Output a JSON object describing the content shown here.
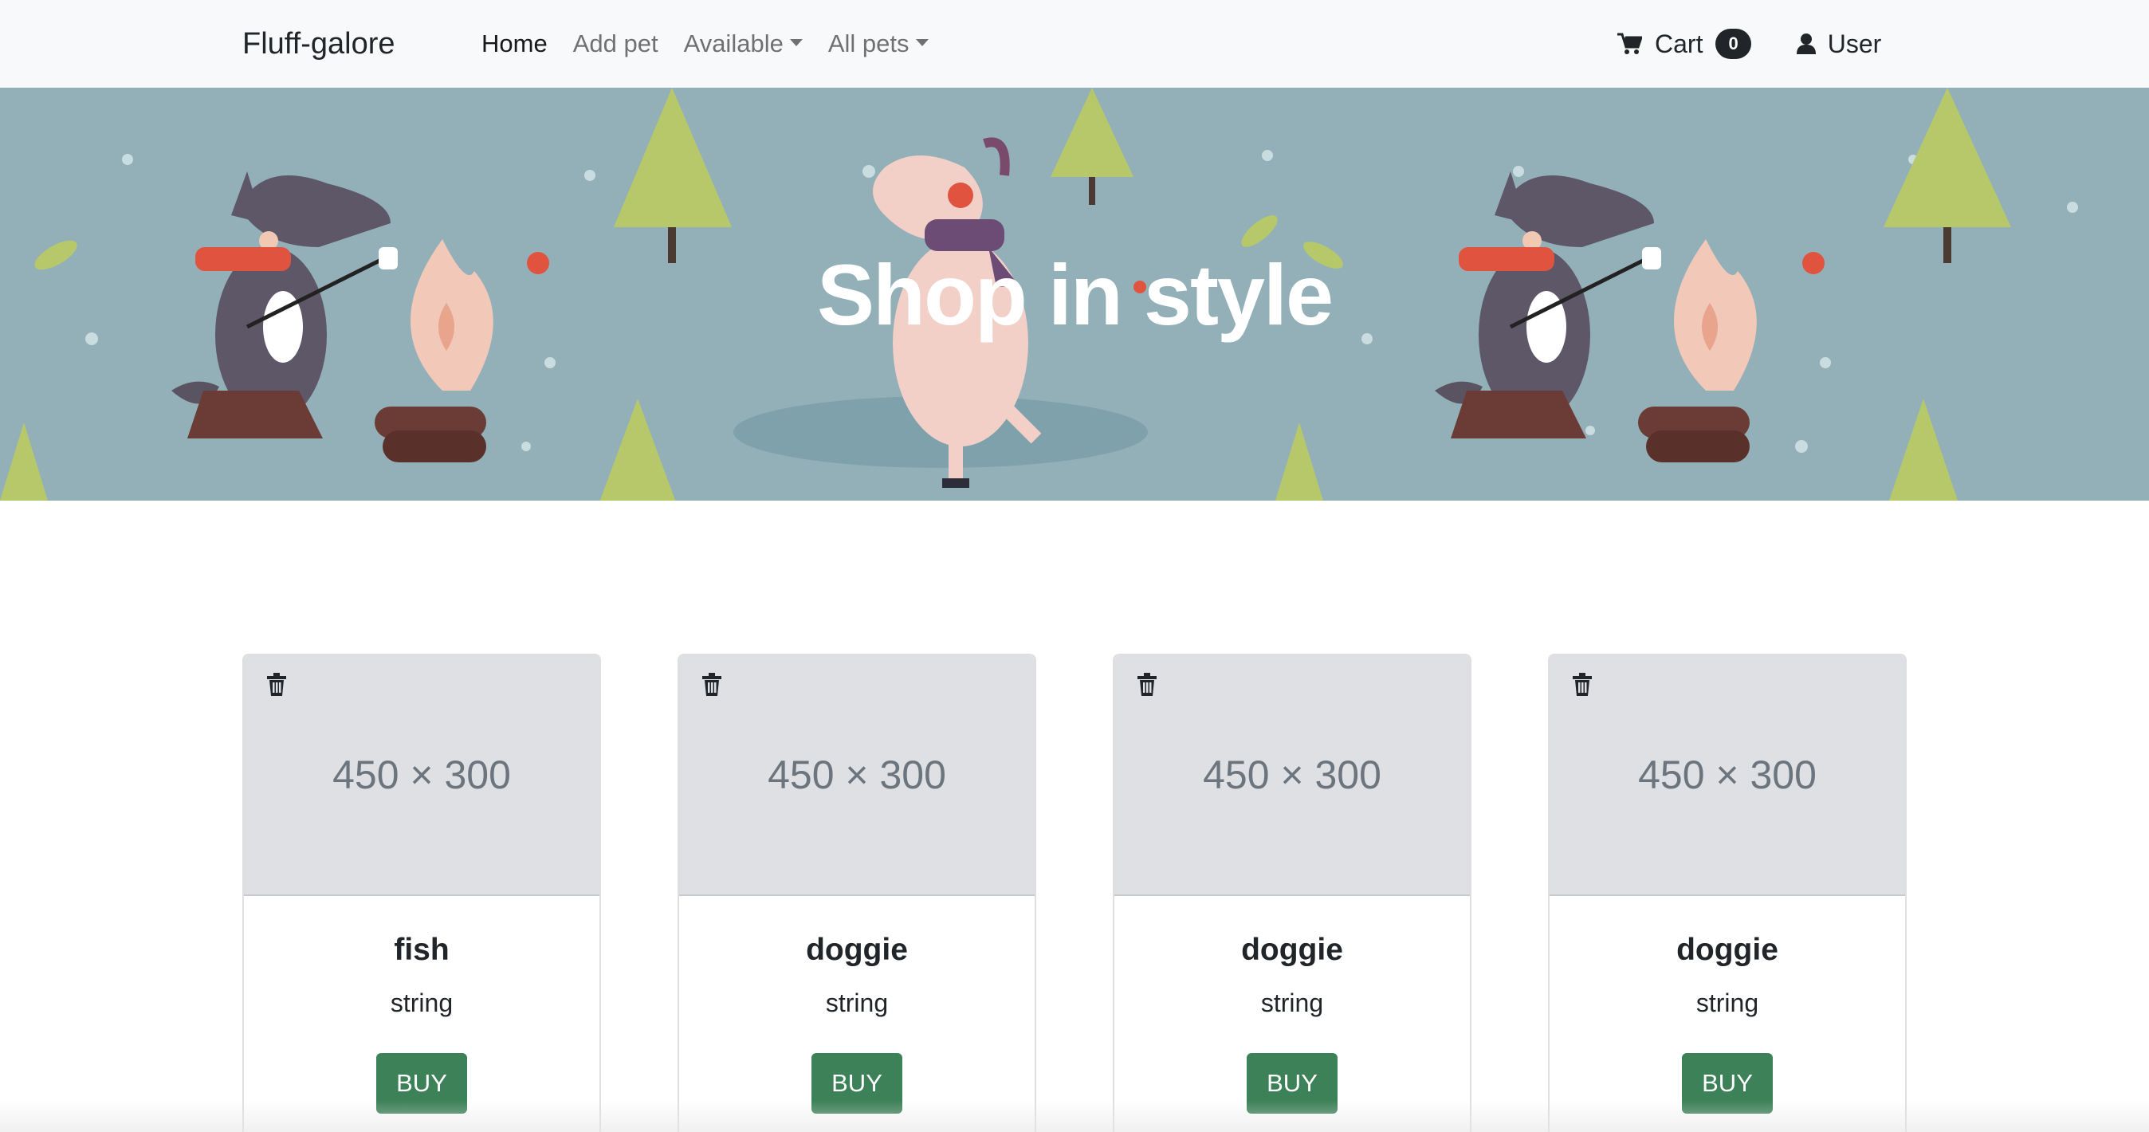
{
  "navbar": {
    "brand": "Fluff-galore",
    "links": [
      {
        "label": "Home"
      },
      {
        "label": "Add pet"
      },
      {
        "label": "Available"
      },
      {
        "label": "All pets"
      }
    ],
    "cart_label": "Cart",
    "cart_count": "0",
    "user_label": "User"
  },
  "hero": {
    "title": "Shop in style"
  },
  "cards": [
    {
      "placeholder": "450 × 300",
      "title": "fish",
      "text": "string",
      "button": "BUY"
    },
    {
      "placeholder": "450 × 300",
      "title": "doggie",
      "text": "string",
      "button": "BUY"
    },
    {
      "placeholder": "450 × 300",
      "title": "doggie",
      "text": "string",
      "button": "BUY"
    },
    {
      "placeholder": "450 × 300",
      "title": "doggie",
      "text": "string",
      "button": "BUY"
    }
  ],
  "colors": {
    "navbar_bg": "#f8f9fa",
    "hero_bg": "#93b0b8",
    "buy_button": "#3c8157",
    "badge": "#212529",
    "image_placeholder": "#dee0e4"
  },
  "icons": [
    "cart-icon",
    "user-icon",
    "trash-icon",
    "caret-down-icon"
  ]
}
